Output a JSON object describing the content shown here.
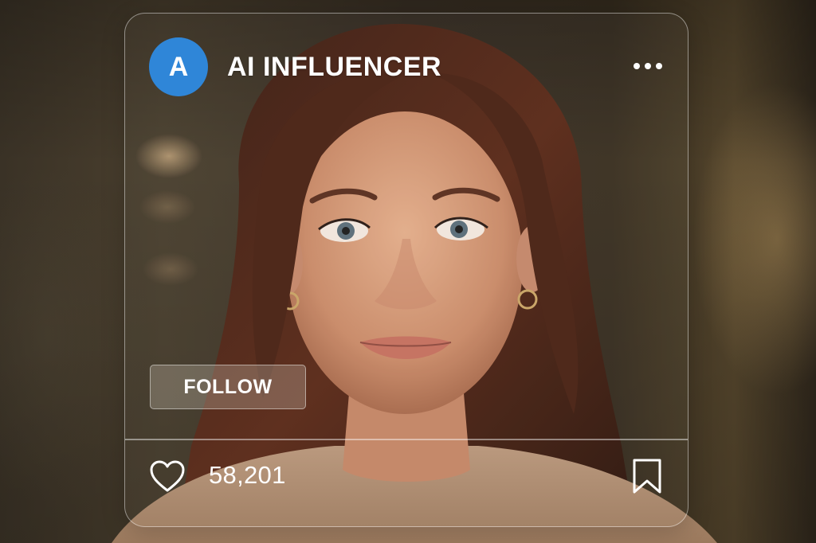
{
  "post": {
    "avatar_letter": "A",
    "username": "AI INFLUENCER",
    "follow_label": "FOLLOW",
    "likes": "58,201"
  },
  "icons": {
    "more": "more-horizontal-icon",
    "like": "heart-icon",
    "save": "bookmark-icon"
  },
  "colors": {
    "avatar_bg": "#2f86d8",
    "text": "#ffffff"
  }
}
